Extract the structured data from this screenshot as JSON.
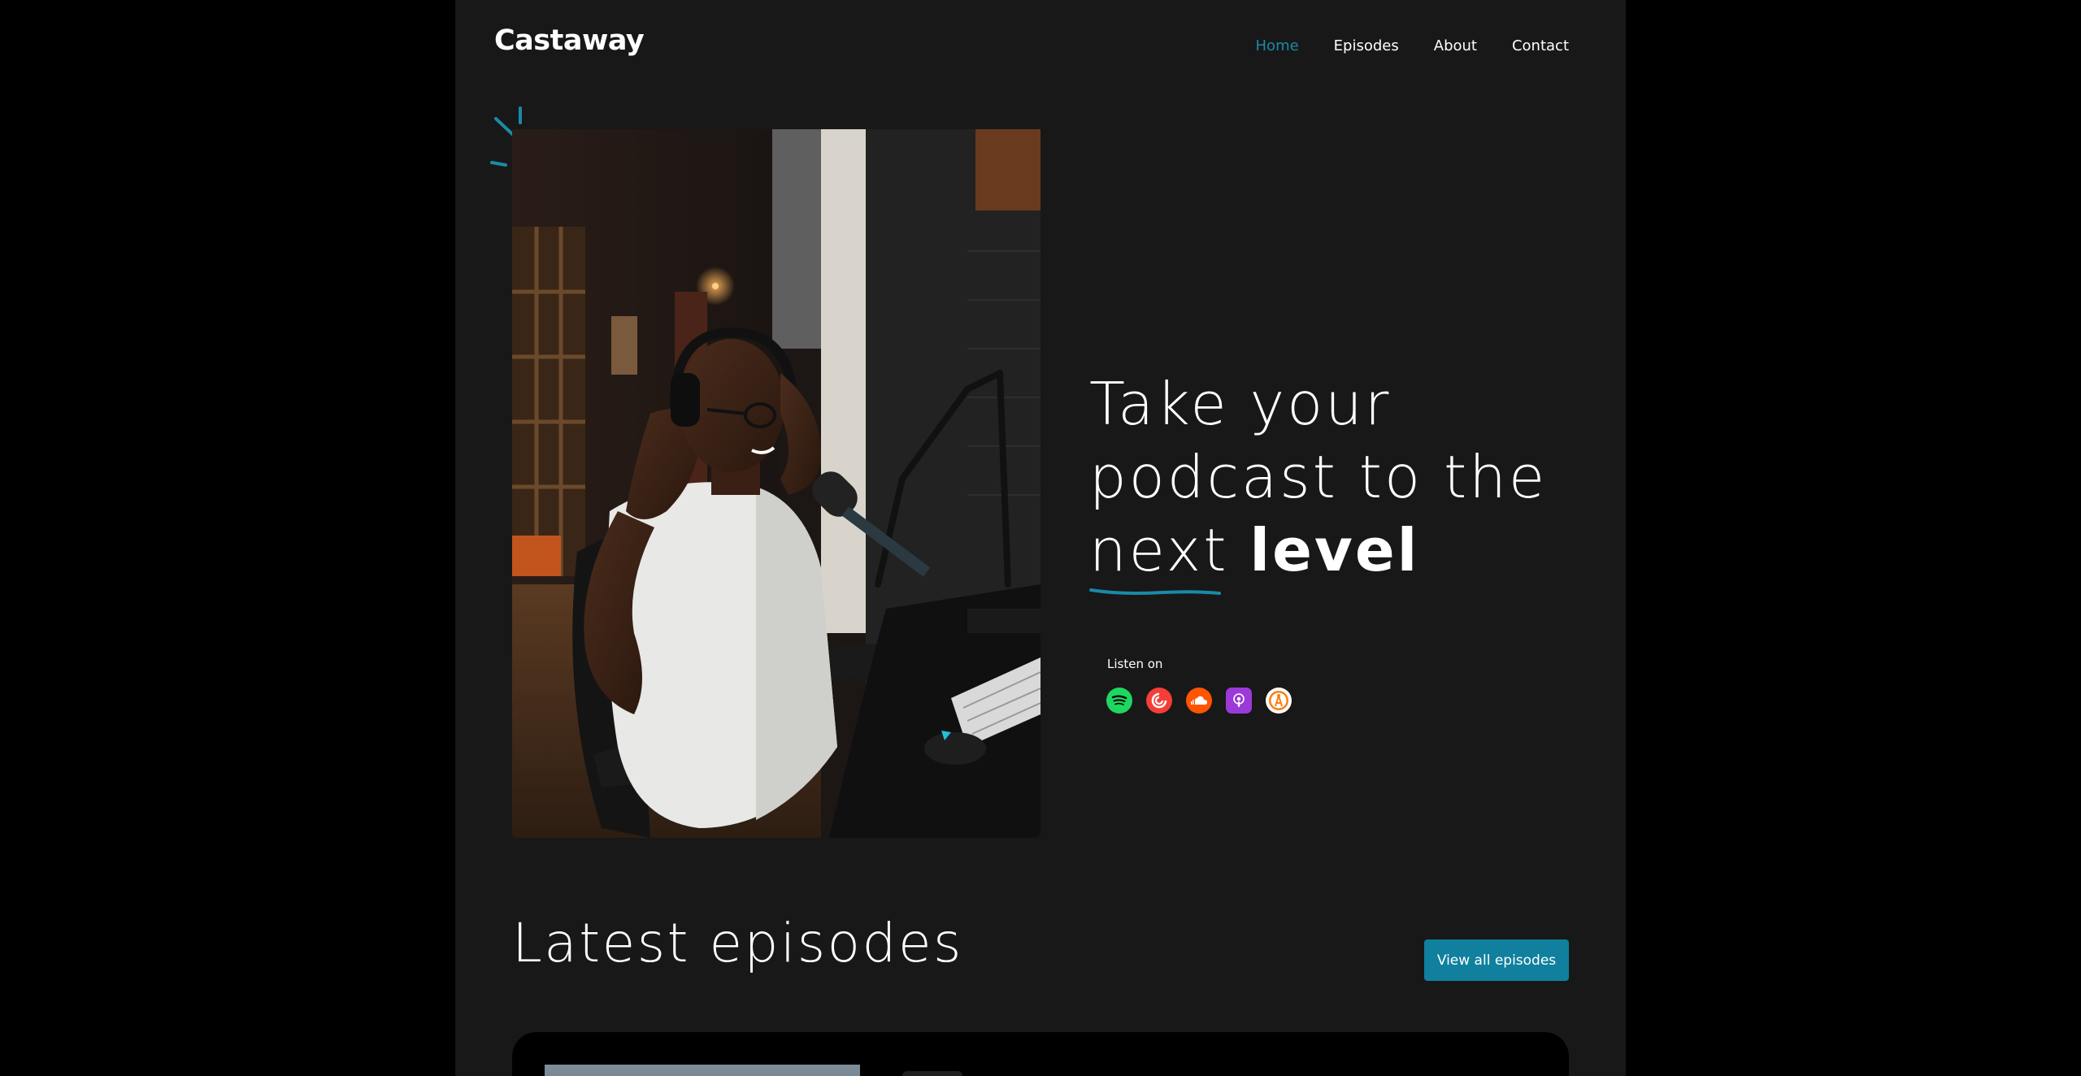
{
  "brand": {
    "name": "Castaway"
  },
  "nav": {
    "items": [
      {
        "label": "Home",
        "active": true
      },
      {
        "label": "Episodes",
        "active": false
      },
      {
        "label": "About",
        "active": false
      },
      {
        "label": "Contact",
        "active": false
      }
    ]
  },
  "hero": {
    "headline": {
      "line1": "Take your",
      "line2": "podcast to the",
      "line3_plain": "next",
      "line3_bold": "level"
    },
    "listen_label": "Listen on",
    "platforms": [
      {
        "name": "spotify-icon",
        "color": "#1ed760"
      },
      {
        "name": "pocket-casts-icon",
        "color": "#f43e37"
      },
      {
        "name": "soundcloud-icon",
        "color": "#ff5500"
      },
      {
        "name": "apple-podcasts-icon",
        "color": "#9b3ad8"
      },
      {
        "name": "overcast-icon",
        "color": "#fc7e0f"
      }
    ]
  },
  "latest": {
    "title": "Latest episodes",
    "view_all_label": "View all episodes"
  },
  "colors": {
    "accent": "#1a8aa8",
    "button": "#10809e",
    "page_bg": "#181818",
    "outer_bg": "#000000"
  }
}
